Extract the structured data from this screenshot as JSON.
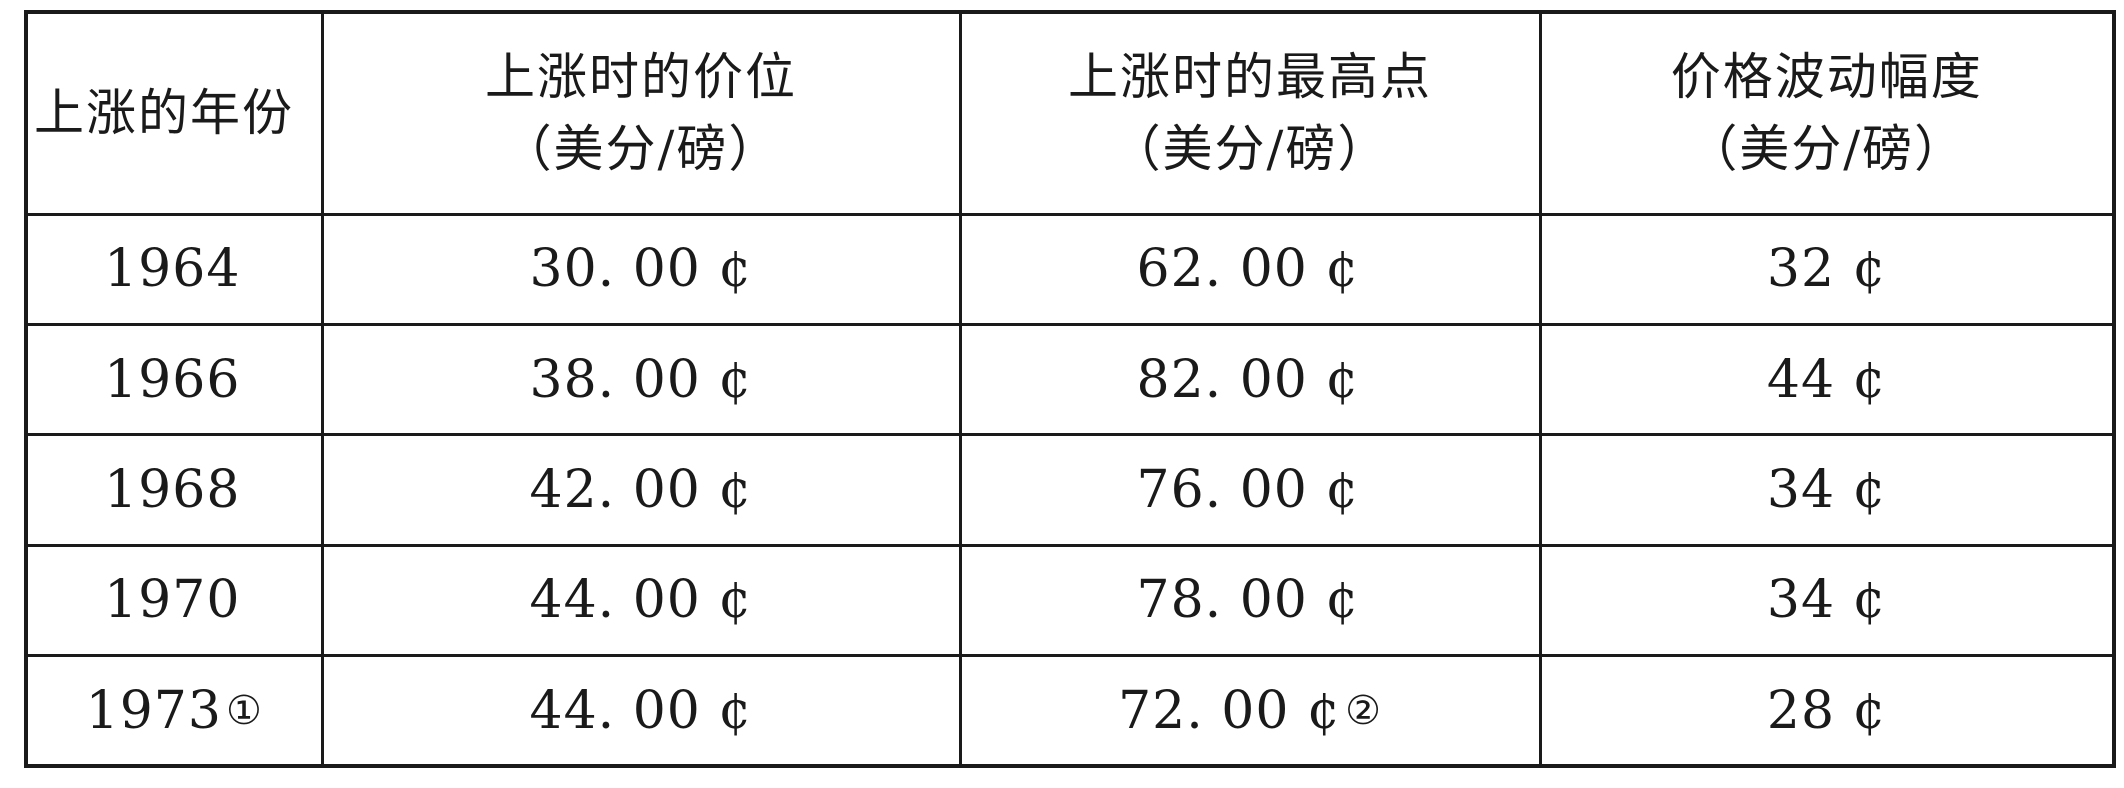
{
  "table": {
    "headers": [
      {
        "line1": "上涨的年份",
        "line2": ""
      },
      {
        "line1": "上涨时的价位",
        "line2": "（美分/磅）"
      },
      {
        "line1": "上涨时的最高点",
        "line2": "（美分/磅）"
      },
      {
        "line1": "价格波动幅度",
        "line2": "（美分/磅）"
      }
    ],
    "rows": [
      {
        "year": "1964",
        "year_note": "",
        "start_price": "30. 00 ¢",
        "peak": "62. 00 ¢",
        "peak_note": "",
        "range": "32 ¢"
      },
      {
        "year": "1966",
        "year_note": "",
        "start_price": "38. 00 ¢",
        "peak": "82. 00 ¢",
        "peak_note": "",
        "range": "44 ¢"
      },
      {
        "year": "1968",
        "year_note": "",
        "start_price": "42. 00 ¢",
        "peak": "76. 00 ¢",
        "peak_note": "",
        "range": "34 ¢"
      },
      {
        "year": "1970",
        "year_note": "",
        "start_price": "44. 00 ¢",
        "peak": "78. 00 ¢",
        "peak_note": "",
        "range": "34 ¢"
      },
      {
        "year": "1973",
        "year_note": "①",
        "start_price": "44. 00 ¢",
        "peak": "72. 00 ¢",
        "peak_note": "②",
        "range": "28 ¢"
      }
    ]
  }
}
